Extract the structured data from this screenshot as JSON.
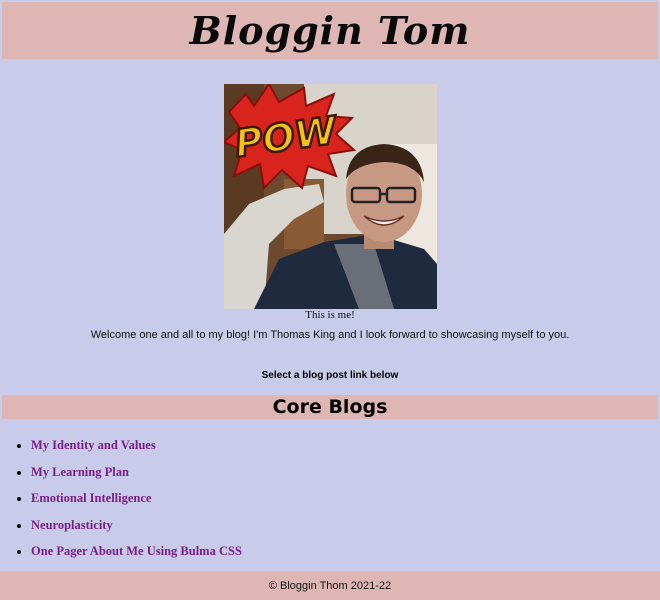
{
  "header": {
    "title": "Bloggin Tom"
  },
  "hero": {
    "image_badge_text": "POW",
    "caption": "This is me!",
    "welcome": "Welcome one and all to my blog! I'm Thomas King and I look forward to showcasing myself to you."
  },
  "blog_nav": {
    "prompt": "Select a blog post link below",
    "section_title": "Core Blogs",
    "links": [
      {
        "label": "My Identity and Values"
      },
      {
        "label": "My Learning Plan"
      },
      {
        "label": "Emotional Intelligence"
      },
      {
        "label": "Neuroplasticity"
      },
      {
        "label": "One Pager About Me Using Bulma CSS"
      }
    ]
  },
  "footer": {
    "text": "© Bloggin Thom 2021-22"
  },
  "colors": {
    "page_background": "#c8cbe9",
    "bar_background": "#deb7b5",
    "link_color": "#7a1f86"
  }
}
